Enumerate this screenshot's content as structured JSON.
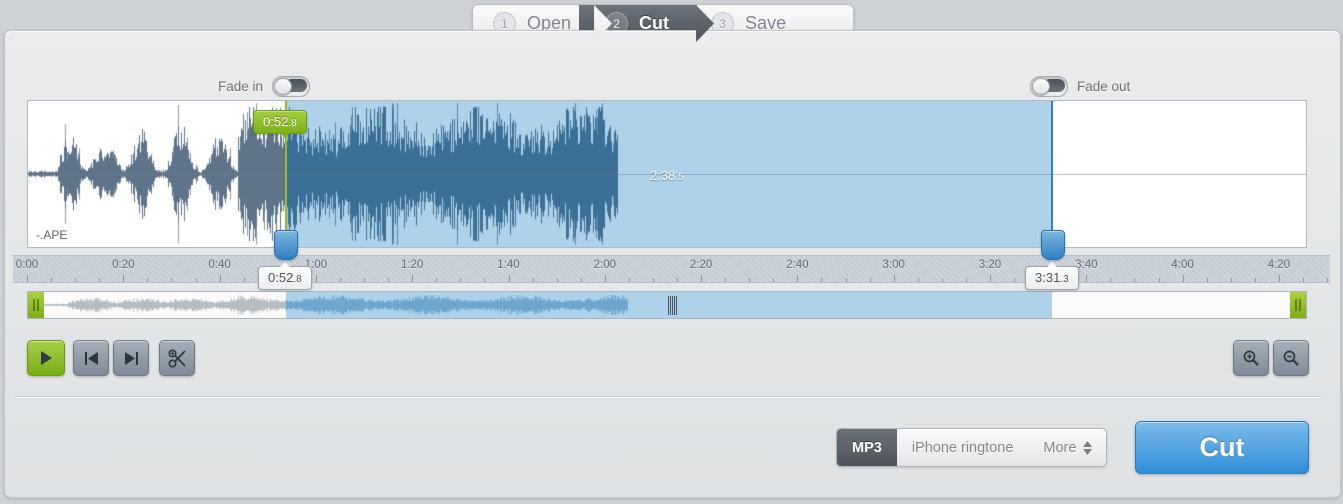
{
  "steps": [
    {
      "num": "1",
      "label": "Open"
    },
    {
      "num": "2",
      "label": "Cut"
    },
    {
      "num": "3",
      "label": "Save"
    }
  ],
  "fade": {
    "in_label": "Fade in",
    "out_label": "Fade out",
    "in_on": false,
    "out_on": false
  },
  "waveform": {
    "file_label": "-.APE",
    "start_badge_main": "0:52",
    "start_badge_dec": ".8",
    "duration_main": "2:38",
    "duration_dec": ".5",
    "selection_start": "0:52.8",
    "selection_end": "3:31.3"
  },
  "handles": {
    "start_main": "0:52",
    "start_dec": ".8",
    "end_main": "3:31",
    "end_dec": ".3"
  },
  "ruler": {
    "ticks": [
      "0:00",
      "0:20",
      "0:40",
      "1:00",
      "1:20",
      "1:40",
      "2:00",
      "2:20",
      "2:40",
      "3:00",
      "3:20",
      "3:40",
      "4:00",
      "4:20"
    ]
  },
  "transport": {
    "play": "play-icon",
    "prev": "skip-start-icon",
    "next": "skip-end-icon",
    "scissors": "scissors-icon"
  },
  "zoom_controls": {
    "zoom_in": "zoom-in-icon",
    "zoom_out": "zoom-out-icon"
  },
  "format": {
    "options": [
      "MP3",
      "iPhone ringtone",
      "More"
    ],
    "selected": "MP3"
  },
  "action": {
    "cut_label": "Cut"
  },
  "colors": {
    "accent_green": "#93c01f",
    "accent_blue": "#2f8ed8",
    "selection_fill": "#aed2ea",
    "waveform_dark": "#3b6f96"
  }
}
